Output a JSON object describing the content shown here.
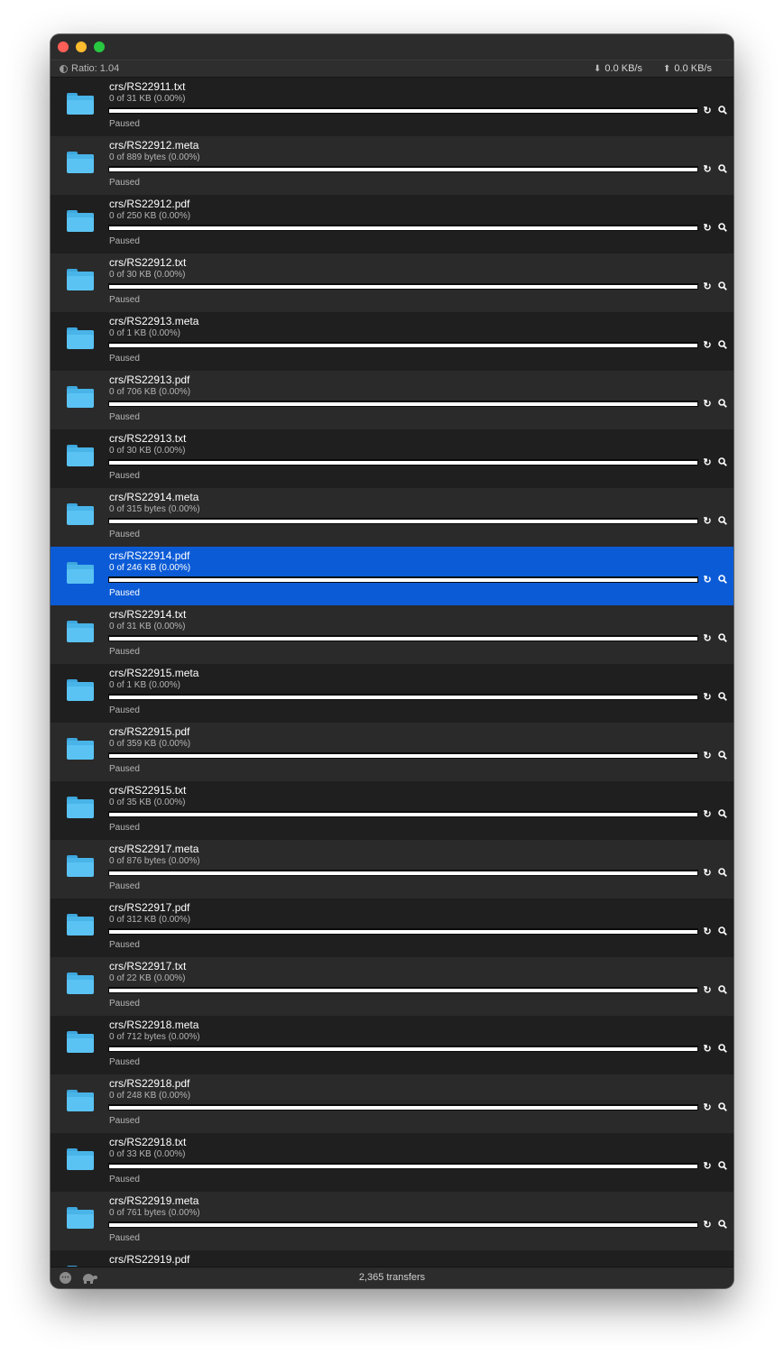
{
  "stats": {
    "ratio": "Ratio: 1.04",
    "download_speed": "0.0 KB/s",
    "upload_speed": "0.0 KB/s"
  },
  "transfers": [
    {
      "name": "crs/RS22911.txt",
      "progress_text": "0 of 31 KB (0.00%)",
      "status": "Paused",
      "progress": 0
    },
    {
      "name": "crs/RS22912.meta",
      "progress_text": "0 of 889 bytes (0.00%)",
      "status": "Paused",
      "progress": 0
    },
    {
      "name": "crs/RS22912.pdf",
      "progress_text": "0 of 250 KB (0.00%)",
      "status": "Paused",
      "progress": 0
    },
    {
      "name": "crs/RS22912.txt",
      "progress_text": "0 of 30 KB (0.00%)",
      "status": "Paused",
      "progress": 0
    },
    {
      "name": "crs/RS22913.meta",
      "progress_text": "0 of 1 KB (0.00%)",
      "status": "Paused",
      "progress": 0
    },
    {
      "name": "crs/RS22913.pdf",
      "progress_text": "0 of 706 KB (0.00%)",
      "status": "Paused",
      "progress": 0
    },
    {
      "name": "crs/RS22913.txt",
      "progress_text": "0 of 30 KB (0.00%)",
      "status": "Paused",
      "progress": 0
    },
    {
      "name": "crs/RS22914.meta",
      "progress_text": "0 of 315 bytes (0.00%)",
      "status": "Paused",
      "progress": 0
    },
    {
      "name": "crs/RS22914.pdf",
      "progress_text": "0 of 246 KB (0.00%)",
      "status": "Paused",
      "progress": 0,
      "selected": true
    },
    {
      "name": "crs/RS22914.txt",
      "progress_text": "0 of 31 KB (0.00%)",
      "status": "Paused",
      "progress": 0
    },
    {
      "name": "crs/RS22915.meta",
      "progress_text": "0 of 1 KB (0.00%)",
      "status": "Paused",
      "progress": 0
    },
    {
      "name": "crs/RS22915.pdf",
      "progress_text": "0 of 359 KB (0.00%)",
      "status": "Paused",
      "progress": 0
    },
    {
      "name": "crs/RS22915.txt",
      "progress_text": "0 of 35 KB (0.00%)",
      "status": "Paused",
      "progress": 0
    },
    {
      "name": "crs/RS22917.meta",
      "progress_text": "0 of 876 bytes (0.00%)",
      "status": "Paused",
      "progress": 0
    },
    {
      "name": "crs/RS22917.pdf",
      "progress_text": "0 of 312 KB (0.00%)",
      "status": "Paused",
      "progress": 0
    },
    {
      "name": "crs/RS22917.txt",
      "progress_text": "0 of 22 KB (0.00%)",
      "status": "Paused",
      "progress": 0
    },
    {
      "name": "crs/RS22918.meta",
      "progress_text": "0 of 712 bytes (0.00%)",
      "status": "Paused",
      "progress": 0
    },
    {
      "name": "crs/RS22918.pdf",
      "progress_text": "0 of 248 KB (0.00%)",
      "status": "Paused",
      "progress": 0
    },
    {
      "name": "crs/RS22918.txt",
      "progress_text": "0 of 33 KB (0.00%)",
      "status": "Paused",
      "progress": 0
    },
    {
      "name": "crs/RS22919.meta",
      "progress_text": "0 of 761 bytes (0.00%)",
      "status": "Paused",
      "progress": 0
    },
    {
      "name": "crs/RS22919.pdf",
      "progress_text": "",
      "status": "",
      "progress": 0
    }
  ],
  "row_icons": {
    "file": "folder-icon",
    "resume": "resume-icon",
    "reveal": "magnifier-icon"
  },
  "footer": {
    "transfer_count": "2,365 transfers"
  },
  "colors": {
    "selection": "#0b5bd6",
    "folder": "#5bc3f3",
    "window_bg": "#1f1f1f"
  }
}
